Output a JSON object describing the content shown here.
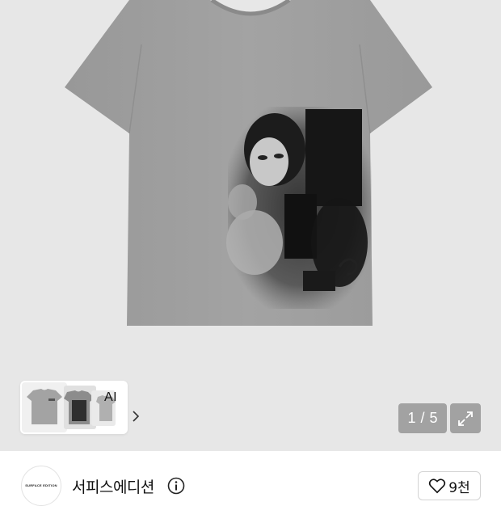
{
  "gallery": {
    "current_page": "1",
    "total_pages": "5",
    "page_separator": "/",
    "background_color": "#e7e7e7",
    "tshirt_color": "#9c9c9c"
  },
  "ai_card": {
    "label": "AI",
    "thumbnails": [
      "tshirt-front-thumbnail",
      "tshirt-print-thumbnail",
      "tshirt-back-thumbnail"
    ]
  },
  "icons": {
    "expand": "expand-icon",
    "chevron": "chevron-right-icon",
    "info": "info-icon",
    "heart": "heart-icon"
  },
  "brand": {
    "name": "서피스에디션",
    "logo_text": "SURFACE EDITION"
  },
  "like": {
    "count": "9천"
  }
}
